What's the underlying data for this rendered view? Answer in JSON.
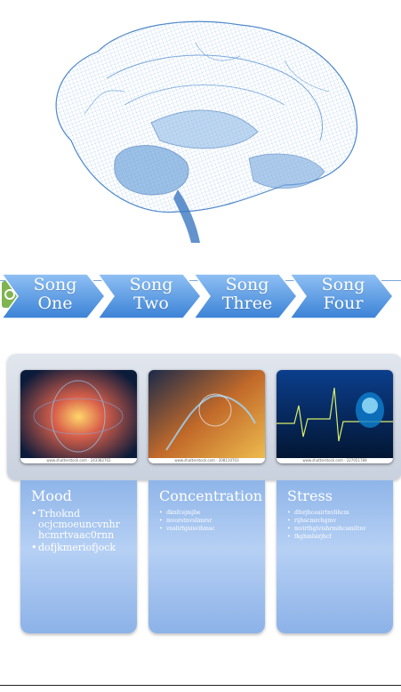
{
  "songs": [
    {
      "line1": "Song",
      "line2": "One"
    },
    {
      "line1": "Song",
      "line2": "Two"
    },
    {
      "line1": "Song",
      "line2": "Three"
    },
    {
      "line1": "Song",
      "line2": "Four"
    }
  ],
  "cards": [
    {
      "title": "Mood",
      "items": [
        "Trhoknd ocjcmoeuncvnhr hcmrtvaac0rnn",
        "dofjkmeriofjock"
      ]
    },
    {
      "title": "Concentration",
      "items": [
        "dknfcejmjbe",
        "mvorstnvslimrsr",
        "vnslirhjnisvihmsc"
      ]
    },
    {
      "title": "Stress",
      "items": [
        "dferjhceairtnvlihcm",
        "rijhscmrchgmv",
        "mvirthglvishrmihcsmiltnv",
        "fkghmlsirjhcf"
      ]
    }
  ],
  "thumb_captions": [
    "www.shutterstock.com · 243382702",
    "www.shutterstock.com · 208110703",
    "www.shutterstock.com · 227051788"
  ],
  "colors": {
    "chevron": "#5a9ae4",
    "card": "#9fc0ee",
    "panel": "#d4dbe6"
  },
  "icons": [
    "refresh-icon"
  ]
}
